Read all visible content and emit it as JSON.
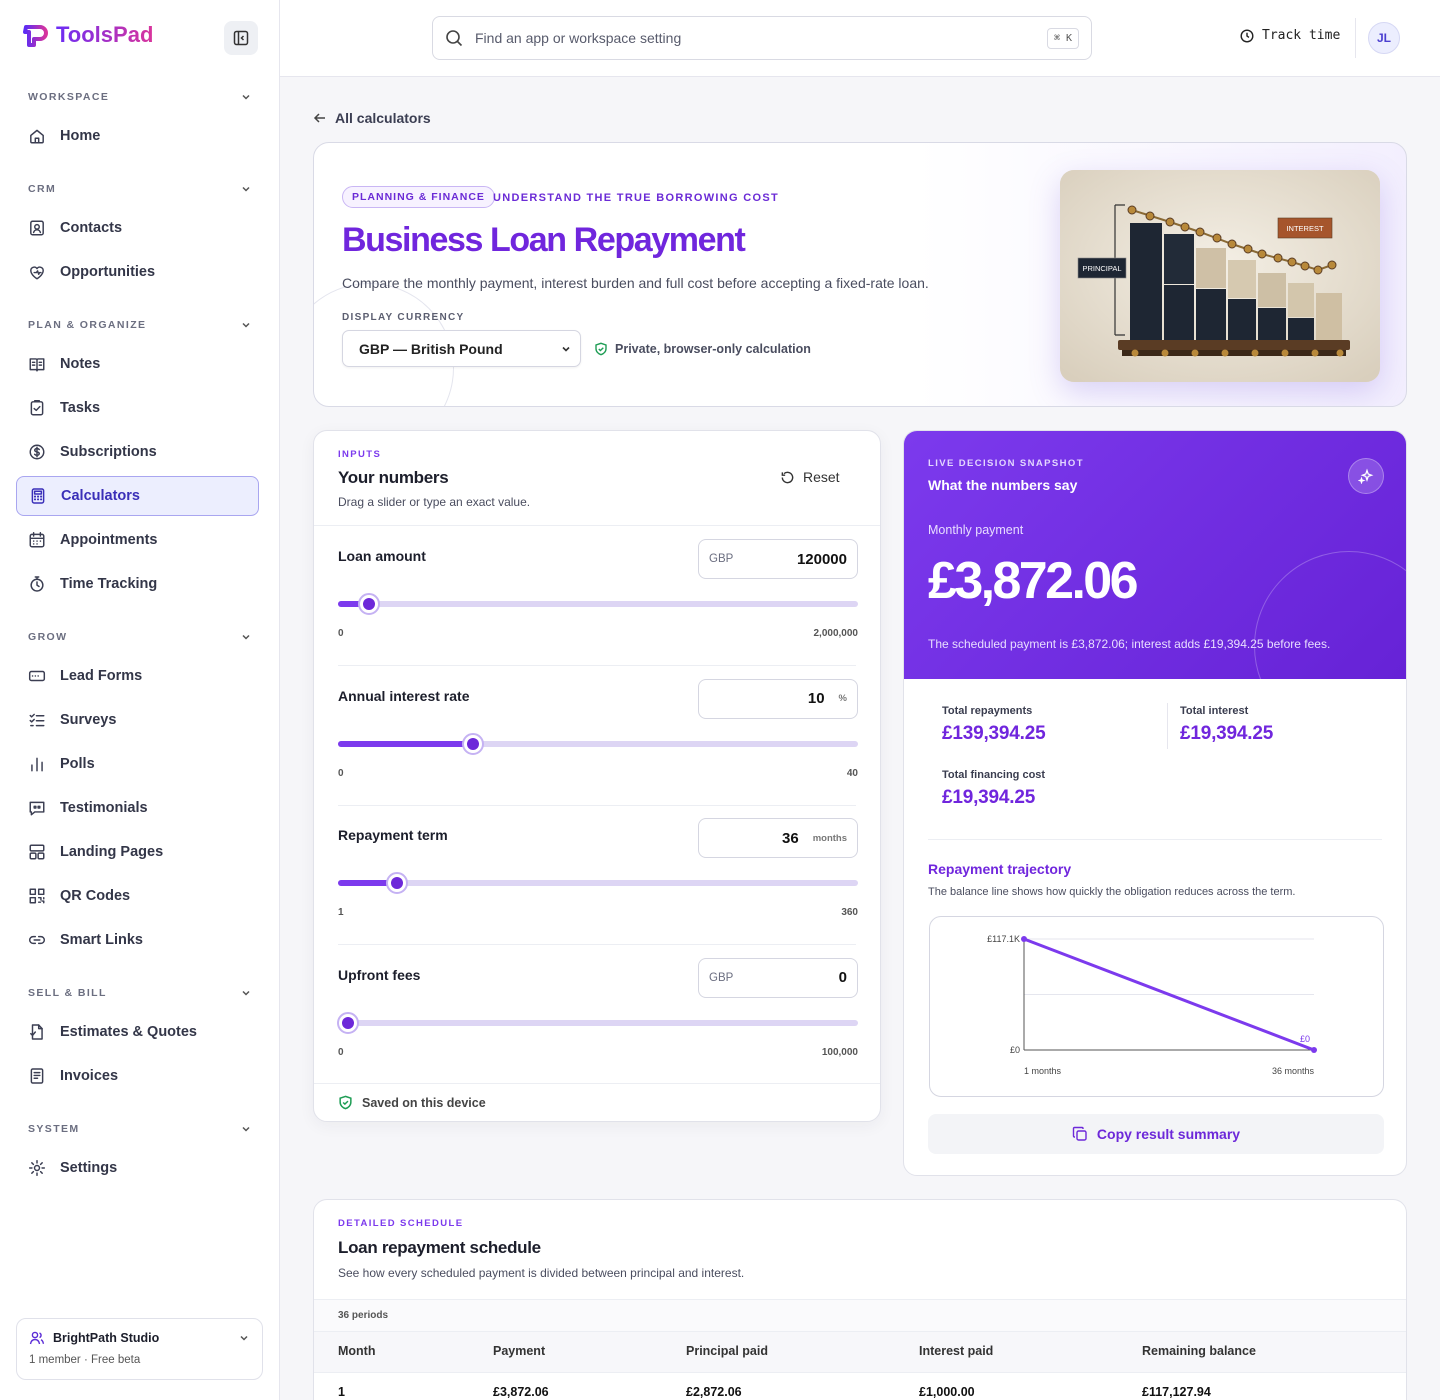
{
  "app": {
    "name": "ToolsPad",
    "logo_mark": "P"
  },
  "sidebar": {
    "sections": [
      {
        "label": "WORKSPACE",
        "items": [
          {
            "label": "Home",
            "icon": "home-icon"
          }
        ]
      },
      {
        "label": "CRM",
        "items": [
          {
            "label": "Contacts",
            "icon": "contacts-icon"
          },
          {
            "label": "Opportunities",
            "icon": "opportunities-icon"
          }
        ]
      },
      {
        "label": "PLAN & ORGANIZE",
        "items": [
          {
            "label": "Notes",
            "icon": "notes-icon"
          },
          {
            "label": "Tasks",
            "icon": "tasks-icon"
          },
          {
            "label": "Subscriptions",
            "icon": "dollar-icon"
          },
          {
            "label": "Calculators",
            "icon": "calculator-icon",
            "active": true
          },
          {
            "label": "Appointments",
            "icon": "calendar-icon"
          },
          {
            "label": "Time Tracking",
            "icon": "stopwatch-icon"
          }
        ]
      },
      {
        "label": "GROW",
        "items": [
          {
            "label": "Lead Forms",
            "icon": "form-icon"
          },
          {
            "label": "Surveys",
            "icon": "survey-icon"
          },
          {
            "label": "Polls",
            "icon": "poll-icon"
          },
          {
            "label": "Testimonials",
            "icon": "testimonial-icon"
          },
          {
            "label": "Landing Pages",
            "icon": "landing-icon"
          },
          {
            "label": "QR Codes",
            "icon": "qr-icon"
          },
          {
            "label": "Smart Links",
            "icon": "link-icon"
          }
        ]
      },
      {
        "label": "SELL & BILL",
        "items": [
          {
            "label": "Estimates & Quotes",
            "icon": "estimate-icon"
          },
          {
            "label": "Invoices",
            "icon": "invoice-icon"
          }
        ]
      },
      {
        "label": "SYSTEM",
        "items": [
          {
            "label": "Settings",
            "icon": "gear-icon"
          }
        ]
      }
    ],
    "workspace": {
      "name": "BrightPath Studio",
      "meta": "1 member · Free beta"
    }
  },
  "topbar": {
    "search_placeholder": "Find an app or workspace setting",
    "shortcut": "⌘ K",
    "track_time": "Track time",
    "avatar_initials": "JL"
  },
  "back_link": "All calculators",
  "hero": {
    "pill": "PLANNING & FINANCE",
    "eyebrow": "UNDERSTAND THE TRUE BORROWING COST",
    "title": "Business Loan Repayment",
    "description": "Compare the monthly payment, interest burden and full cost before accepting a fixed-rate loan.",
    "currency_label": "DISPLAY CURRENCY",
    "currency_value": "GBP — British Pound",
    "privacy_note": "Private, browser-only calculation",
    "image_labels": {
      "principal": "PRINCIPAL",
      "interest": "INTEREST"
    }
  },
  "inputs": {
    "kicker": "INPUTS",
    "title": "Your numbers",
    "subtitle": "Drag a slider or type an exact value.",
    "reset": "Reset",
    "fields": [
      {
        "label": "Loan amount",
        "prefix": "GBP",
        "value": "120000",
        "suffix": "",
        "min": "0",
        "max": "2,000,000",
        "fraction": 0.06
      },
      {
        "label": "Annual interest rate",
        "prefix": "",
        "value": "10",
        "suffix": "%",
        "min": "0",
        "max": "40",
        "fraction": 0.26
      },
      {
        "label": "Repayment term",
        "prefix": "",
        "value": "36",
        "suffix": "months",
        "min": "1",
        "max": "360",
        "fraction": 0.113
      },
      {
        "label": "Upfront fees",
        "prefix": "GBP",
        "value": "0",
        "suffix": "",
        "min": "0",
        "max": "100,000",
        "fraction": 0.02
      }
    ],
    "saved_note": "Saved on this device"
  },
  "snapshot": {
    "kicker": "LIVE DECISION SNAPSHOT",
    "title": "What the numbers say",
    "monthly_label": "Monthly payment",
    "monthly_value": "£3,872.06",
    "summary": "The scheduled payment is £3,872.06; interest adds £19,394.25 before fees.",
    "stats": [
      {
        "label": "Total repayments",
        "value": "£139,394.25"
      },
      {
        "label": "Total interest",
        "value": "£19,394.25"
      },
      {
        "label": "Total financing cost",
        "value": "£19,394.25"
      }
    ],
    "trajectory_title": "Repayment trajectory",
    "trajectory_sub": "The balance line shows how quickly the obligation reduces across the term.",
    "copy_button": "Copy result summary"
  },
  "chart_data": {
    "type": "line",
    "x": [
      1,
      36
    ],
    "series": [
      {
        "values": [
          117127.94,
          0
        ]
      }
    ],
    "x_tick_labels": [
      "1 months",
      "36 months"
    ],
    "y_tick_labels": [
      "£117.1K",
      "£0"
    ],
    "end_label": "£0",
    "ylim": [
      0,
      117100
    ],
    "grid": true,
    "color": "#7c3aed"
  },
  "schedule": {
    "kicker": "DETAILED SCHEDULE",
    "title": "Loan repayment schedule",
    "subtitle": "See how every scheduled payment is divided between principal and interest.",
    "periods": "36 periods",
    "columns": [
      "Month",
      "Payment",
      "Principal paid",
      "Interest paid",
      "Remaining balance"
    ],
    "rows": [
      [
        "1",
        "£3,872.06",
        "£2,872.06",
        "£1,000.00",
        "£117,127.94"
      ]
    ]
  }
}
